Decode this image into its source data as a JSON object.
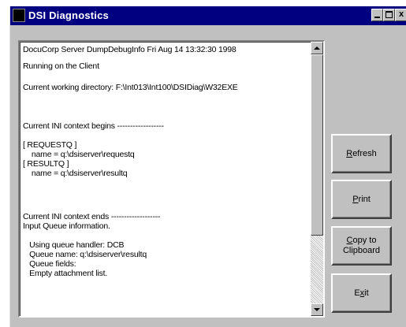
{
  "window": {
    "title": "DSI Diagnostics",
    "controls": {
      "minimize": "",
      "maximize": "",
      "close": "x"
    }
  },
  "output": {
    "lines": [
      "DocuCorp Server DumpDebugInfo Fri Aug 14 13:32:30 1998",
      "",
      "Running on the Client",
      "",
      "Current working directory: F:\\Int013\\Int100\\DSIDiag\\W32EXE",
      "",
      "",
      "Current INI context begins ------------------",
      "",
      "[ REQUESTQ ]",
      "    name = q:\\dsiserver\\requestq",
      "[ RESULTQ ]",
      "    name = q:\\dsiserver\\resultq",
      "",
      "",
      "Current INI context ends -------------------",
      "Input Queue information.",
      "",
      "   Using queue handler: DCB",
      "   Queue name: q:\\dsiserver\\resultq",
      "   Queue fields:",
      "   Empty attachment list."
    ]
  },
  "buttons": {
    "refresh": {
      "label": "Refresh",
      "accel_index": 0
    },
    "print": {
      "label": "Print",
      "accel_index": 0
    },
    "copy": {
      "label": "Copy to\nClipboard",
      "accel_index": 0
    },
    "exit": {
      "label": "Exit",
      "accel_index": 1
    }
  },
  "colors": {
    "titlebar": "#000080",
    "face": "#c0c0c0",
    "text_bg": "#ffffff"
  }
}
